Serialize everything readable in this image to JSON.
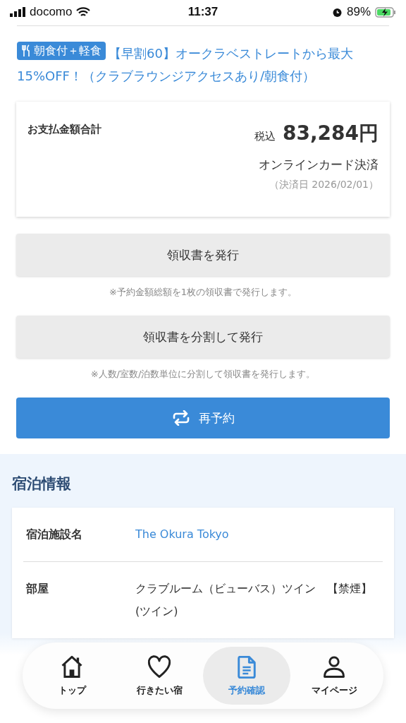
{
  "status_bar": {
    "carrier": "docomo",
    "time": "11:37",
    "battery": "89%"
  },
  "plan": {
    "badge": "朝食付＋軽食",
    "title": "【早割60】オークラベストレートから最大15%OFF！（クラブラウンジアクセスあり/朝食付）"
  },
  "payment": {
    "label": "お支払金額合計",
    "tax_label": "税込",
    "amount": "83,284円",
    "method": "オンラインカード決済",
    "date": "（決済日 2026/02/01）"
  },
  "actions": [
    {
      "kind": "plain",
      "label": "領収書を発行",
      "note": "※予約金額総額を1枚の領収書で発行します。"
    },
    {
      "kind": "plain",
      "label": "領収書を分割して発行",
      "note": "※人数/室数/泊数単位に分割して領収書を発行します。"
    },
    {
      "kind": "primary",
      "label": "再予約"
    }
  ],
  "stay": {
    "title": "宿泊情報",
    "rows": [
      {
        "label": "宿泊施設名",
        "value": "The Okura Tokyo",
        "kind": "link"
      },
      {
        "label": "部屋",
        "value": "クラブルーム（ビューバス）ツイン　【禁煙】 (ツイン)",
        "kind": "text"
      }
    ]
  },
  "tab_bar": [
    {
      "label": "トップ",
      "kind": "home",
      "selected": false
    },
    {
      "label": "行きたい宿",
      "kind": "heart",
      "selected": false
    },
    {
      "label": "予約確認",
      "kind": "doc",
      "selected": true
    },
    {
      "label": "マイページ",
      "kind": "person",
      "selected": false
    }
  ]
}
